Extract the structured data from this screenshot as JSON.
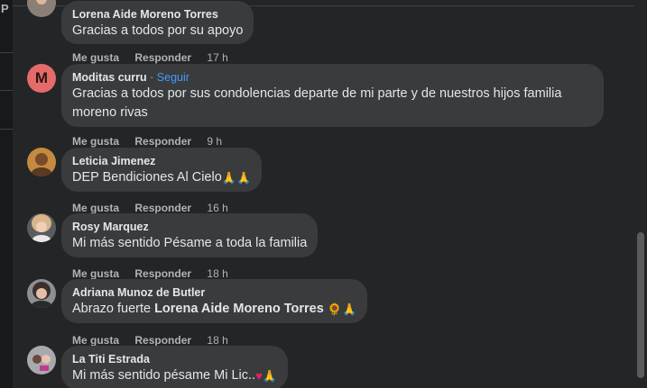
{
  "left_strip": {
    "glyph": "P"
  },
  "comments": [
    {
      "name": "Lorena Aide Moreno Torres",
      "text": "Gracias a todos por su apoyo",
      "like": "Me gusta",
      "reply": "Responder",
      "time": "17 h"
    },
    {
      "name": "Moditas curru",
      "follow": "Seguir",
      "dot": "·",
      "avatar_letter": "M",
      "avatar_color": "#e56a6a",
      "text_line1": "Gracias a todos por sus condolencias departe de mi parte y de nuestros hijos familia",
      "text_line2": "moreno rivas",
      "like": "Me gusta",
      "reply": "Responder",
      "time": "9 h"
    },
    {
      "name": "Leticia Jimenez",
      "text": "DEP Bendiciones Al Cielo",
      "emoji": "🙏🙏",
      "like": "Me gusta",
      "reply": "Responder",
      "time": "16 h"
    },
    {
      "name": "Rosy Marquez",
      "text": "Mi más sentido Pésame a toda la familia",
      "like": "Me gusta",
      "reply": "Responder",
      "time": "18 h"
    },
    {
      "name": "Adriana Munoz de Butler",
      "text_prefix": "Abrazo fuerte ",
      "mention": "Lorena Aide Moreno Torres",
      "emoji_sun": "🌻",
      "emoji_pray": "🙏",
      "like": "Me gusta",
      "reply": "Responder",
      "time": "18 h"
    },
    {
      "name": "La Titi Estrada",
      "text": "Mi más sentido pésame Mi Lic..",
      "emoji_heart": "♥",
      "emoji_pray": "🙏",
      "like": "Me gusta",
      "reply": "Responder",
      "time": ""
    }
  ],
  "colors": {
    "background": "#242526",
    "bubble": "#3a3b3c",
    "link": "#4599ff",
    "secondary_text": "#b0b3b8"
  }
}
